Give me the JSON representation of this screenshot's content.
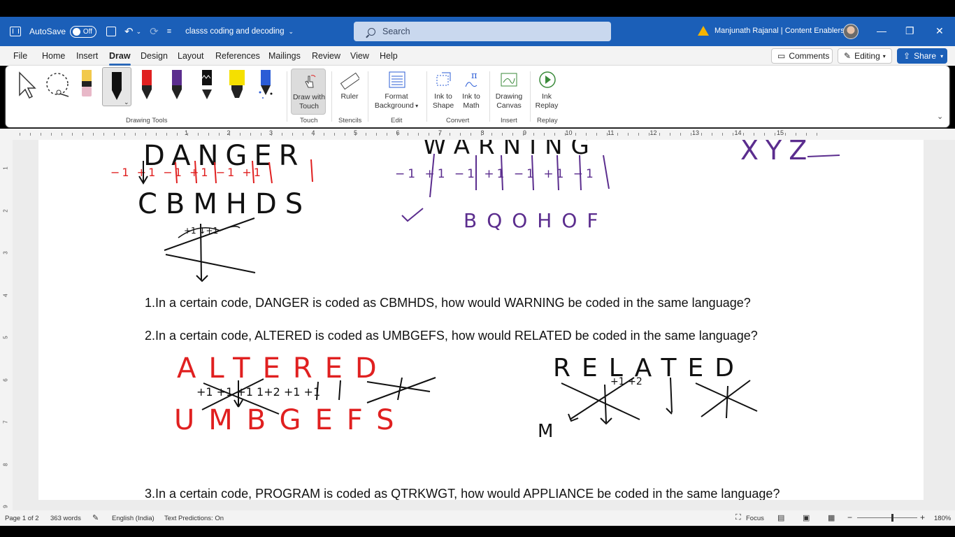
{
  "titlebar": {
    "autosave_label": "AutoSave",
    "autosave_state": "Off",
    "doc_title": "classs coding and decoding",
    "search_placeholder": "Search",
    "user_name": "Manjunath Rajanal | Content Enablers",
    "minimize_glyph": "—",
    "restore_glyph": "❐",
    "close_glyph": "✕",
    "undo_glyph": "↶",
    "dropdown_glyph": "⌄"
  },
  "menu": {
    "tabs": [
      "File",
      "Home",
      "Insert",
      "Draw",
      "Design",
      "Layout",
      "References",
      "Mailings",
      "Review",
      "View",
      "Help"
    ],
    "active_tab": "Draw",
    "comments_label": "Comments",
    "editing_label": "Editing",
    "share_label": "Share"
  },
  "ribbon": {
    "groups": {
      "drawing_tools": "Drawing Tools",
      "touch": "Touch",
      "stencils": "Stencils",
      "edit": "Edit",
      "convert": "Convert",
      "insert": "Insert",
      "replay": "Replay"
    },
    "buttons": {
      "draw_with_touch_1": "Draw with",
      "draw_with_touch_2": "Touch",
      "ruler": "Ruler",
      "format_background_1": "Format",
      "format_background_2": "Background",
      "ink_to_shape_1": "Ink to",
      "ink_to_shape_2": "Shape",
      "ink_to_math_1": "Ink to",
      "ink_to_math_2": "Math",
      "drawing_canvas_1": "Drawing",
      "drawing_canvas_2": "Canvas",
      "ink_replay_1": "Ink",
      "ink_replay_2": "Replay"
    },
    "pen_colors": [
      "#f2c94c",
      "#111111",
      "#e02020",
      "#5b2d8e",
      "#111111",
      "#f5e000",
      "#2b5cd6"
    ]
  },
  "ruler": {
    "numbers": [
      "1",
      "2",
      "3",
      "4",
      "5",
      "6",
      "7",
      "8",
      "9",
      "10",
      "11",
      "12",
      "13",
      "14",
      "15"
    ],
    "vertical_numbers": [
      "1",
      "2",
      "3",
      "4",
      "5",
      "6",
      "7",
      "8",
      "9"
    ]
  },
  "document": {
    "q1": "1.In a certain code, DANGER is coded as CBMHDS, how would WARNING be coded in the same language?",
    "q2": "2.In a certain code, ALTERED is coded as UMBGEFS, how would RELATED be coded in the same language?",
    "q3": "3.In a certain code, PROGRAM is coded as QTRKWGT, how would APPLIANCE be coded in the same language?",
    "ink": {
      "danger_letters": "DANGER",
      "danger_code": "CBMHDS",
      "danger_marks": "−1 +1 −1 +1 −1 +1",
      "warning_letters": "WARNING",
      "warning_marks": "−1 +1 −1 +1 −1 +1 −1",
      "warning_code": "BQOHOF",
      "xyz": "XYZ",
      "altered_letters": "ALTERED",
      "altered_code": "UMBGEFS",
      "related_letters": "RELATED",
      "related_partial": "M"
    }
  },
  "status": {
    "page": "Page 1 of 2",
    "words": "363 words",
    "language": "English (India)",
    "predictions": "Text Predictions: On",
    "focus": "Focus",
    "zoom": "180%",
    "zoom_minus": "−",
    "zoom_plus": "+"
  }
}
